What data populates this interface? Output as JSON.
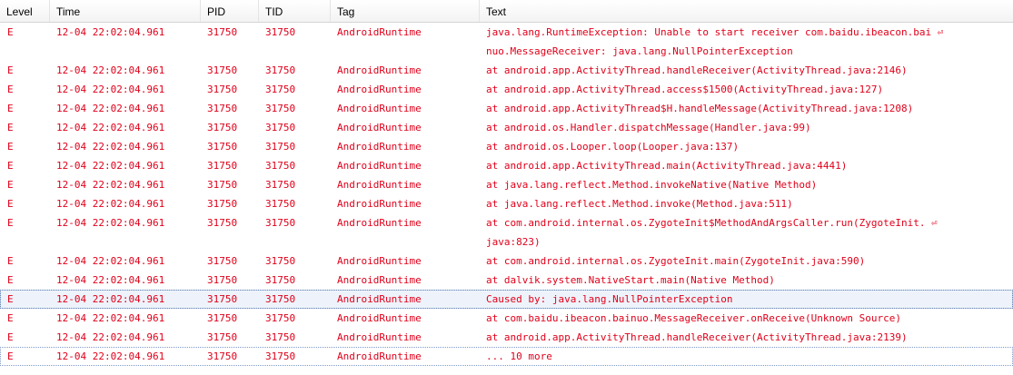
{
  "columns": {
    "level": "Level",
    "time": "Time",
    "pid": "PID",
    "tid": "TID",
    "tag": "Tag",
    "text": "Text"
  },
  "colors": {
    "error": "#e0001a"
  },
  "rows": [
    {
      "level": "E",
      "time": "12-04 22:02:04.961",
      "pid": "31750",
      "tid": "31750",
      "tag": "AndroidRuntime",
      "text": "java.lang.RuntimeException: Unable to start receiver com.baidu.ibeacon.bai ⏎",
      "text2": "nuo.MessageReceiver: java.lang.NullPointerException"
    },
    {
      "level": "E",
      "time": "12-04 22:02:04.961",
      "pid": "31750",
      "tid": "31750",
      "tag": "AndroidRuntime",
      "text": "at android.app.ActivityThread.handleReceiver(ActivityThread.java:2146)"
    },
    {
      "level": "E",
      "time": "12-04 22:02:04.961",
      "pid": "31750",
      "tid": "31750",
      "tag": "AndroidRuntime",
      "text": "at android.app.ActivityThread.access$1500(ActivityThread.java:127)"
    },
    {
      "level": "E",
      "time": "12-04 22:02:04.961",
      "pid": "31750",
      "tid": "31750",
      "tag": "AndroidRuntime",
      "text": "at android.app.ActivityThread$H.handleMessage(ActivityThread.java:1208)"
    },
    {
      "level": "E",
      "time": "12-04 22:02:04.961",
      "pid": "31750",
      "tid": "31750",
      "tag": "AndroidRuntime",
      "text": "at android.os.Handler.dispatchMessage(Handler.java:99)"
    },
    {
      "level": "E",
      "time": "12-04 22:02:04.961",
      "pid": "31750",
      "tid": "31750",
      "tag": "AndroidRuntime",
      "text": "at android.os.Looper.loop(Looper.java:137)"
    },
    {
      "level": "E",
      "time": "12-04 22:02:04.961",
      "pid": "31750",
      "tid": "31750",
      "tag": "AndroidRuntime",
      "text": "at android.app.ActivityThread.main(ActivityThread.java:4441)"
    },
    {
      "level": "E",
      "time": "12-04 22:02:04.961",
      "pid": "31750",
      "tid": "31750",
      "tag": "AndroidRuntime",
      "text": "at java.lang.reflect.Method.invokeNative(Native Method)"
    },
    {
      "level": "E",
      "time": "12-04 22:02:04.961",
      "pid": "31750",
      "tid": "31750",
      "tag": "AndroidRuntime",
      "text": "at java.lang.reflect.Method.invoke(Method.java:511)"
    },
    {
      "level": "E",
      "time": "12-04 22:02:04.961",
      "pid": "31750",
      "tid": "31750",
      "tag": "AndroidRuntime",
      "text": "at com.android.internal.os.ZygoteInit$MethodAndArgsCaller.run(ZygoteInit. ⏎",
      "text2": "java:823)"
    },
    {
      "level": "E",
      "time": "12-04 22:02:04.961",
      "pid": "31750",
      "tid": "31750",
      "tag": "AndroidRuntime",
      "text": "at com.android.internal.os.ZygoteInit.main(ZygoteInit.java:590)"
    },
    {
      "level": "E",
      "time": "12-04 22:02:04.961",
      "pid": "31750",
      "tid": "31750",
      "tag": "AndroidRuntime",
      "text": "at dalvik.system.NativeStart.main(Native Method)"
    },
    {
      "level": "E",
      "time": "12-04 22:02:04.961",
      "pid": "31750",
      "tid": "31750",
      "tag": "AndroidRuntime",
      "text": "Caused by: java.lang.NullPointerException",
      "selected": true
    },
    {
      "level": "E",
      "time": "12-04 22:02:04.961",
      "pid": "31750",
      "tid": "31750",
      "tag": "AndroidRuntime",
      "text": "at com.baidu.ibeacon.bainuo.MessageReceiver.onReceive(Unknown Source)"
    },
    {
      "level": "E",
      "time": "12-04 22:02:04.961",
      "pid": "31750",
      "tid": "31750",
      "tag": "AndroidRuntime",
      "text": "at android.app.ActivityThread.handleReceiver(ActivityThread.java:2139)"
    },
    {
      "level": "E",
      "time": "12-04 22:02:04.961",
      "pid": "31750",
      "tid": "31750",
      "tag": "AndroidRuntime",
      "text": "... 10 more",
      "focused": true
    }
  ]
}
